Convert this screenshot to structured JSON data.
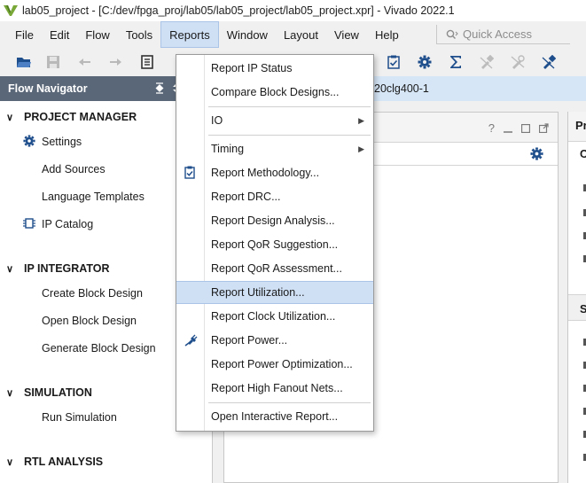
{
  "window": {
    "title": "lab05_project - [C:/dev/fpga_proj/lab05/lab05_project/lab05_project.xpr] - Vivado 2022.1"
  },
  "menubar": {
    "items": [
      {
        "label": "File"
      },
      {
        "label": "Edit"
      },
      {
        "label": "Flow"
      },
      {
        "label": "Tools"
      },
      {
        "label": "Reports",
        "active": true
      },
      {
        "label": "Window"
      },
      {
        "label": "Layout"
      },
      {
        "label": "View"
      },
      {
        "label": "Help"
      }
    ],
    "quick_access_placeholder": "Quick Access"
  },
  "toolbar": {
    "icons": [
      "open-project-icon",
      "save-icon",
      "undo-icon",
      "redo-icon",
      "report-icon",
      "checklist-icon",
      "settings-icon",
      "sigma-icon",
      "disabled-tool-icon",
      "disabled-tool2-icon",
      "pin-tool-icon"
    ]
  },
  "flow_navigator": {
    "title": "Flow Navigator",
    "sections": [
      {
        "label": "PROJECT MANAGER",
        "items": [
          "Settings",
          "Add Sources",
          "Language Templates",
          "IP Catalog"
        ]
      },
      {
        "label": "IP INTEGRATOR",
        "items": [
          "Create Block Design",
          "Open Block Design",
          "Generate Block Design"
        ]
      },
      {
        "label": "SIMULATION",
        "items": [
          "Run Simulation"
        ]
      },
      {
        "label": "RTL ANALYSIS",
        "items": []
      }
    ]
  },
  "part_bar": {
    "text": "20clg400-1"
  },
  "right_panel": {
    "tab_fragment": "Pr",
    "row1_fragment": "O",
    "section_fragment": "S"
  },
  "middle_panel": {
    "help": "?"
  },
  "reports_menu": {
    "items": [
      {
        "label": "Report IP Status",
        "submenu": false
      },
      {
        "label": "Compare Block Designs...",
        "submenu": false
      },
      {
        "label": "IO",
        "submenu": true
      },
      {
        "label": "Timing",
        "submenu": true
      },
      {
        "label": "Report Methodology...",
        "submenu": false,
        "icon": "clipboard-check-icon"
      },
      {
        "label": "Report DRC...",
        "submenu": false
      },
      {
        "label": "Report Design Analysis...",
        "submenu": false
      },
      {
        "label": "Report QoR Suggestion...",
        "submenu": false
      },
      {
        "label": "Report QoR Assessment...",
        "submenu": false
      },
      {
        "label": "Report Utilization...",
        "submenu": false,
        "highlighted": true
      },
      {
        "label": "Report Clock Utilization...",
        "submenu": false
      },
      {
        "label": "Report Power...",
        "submenu": false,
        "icon": "power-plug-icon"
      },
      {
        "label": "Report Power Optimization...",
        "submenu": false
      },
      {
        "label": "Report High Fanout Nets...",
        "submenu": false
      },
      {
        "label": "Open Interactive Report...",
        "submenu": false
      }
    ]
  },
  "colors": {
    "nav_header": "#5a6778",
    "menu_highlight": "#cfe0f5",
    "part_bar": "#d6e6f7",
    "icon_blue": "#1f4e8c"
  }
}
